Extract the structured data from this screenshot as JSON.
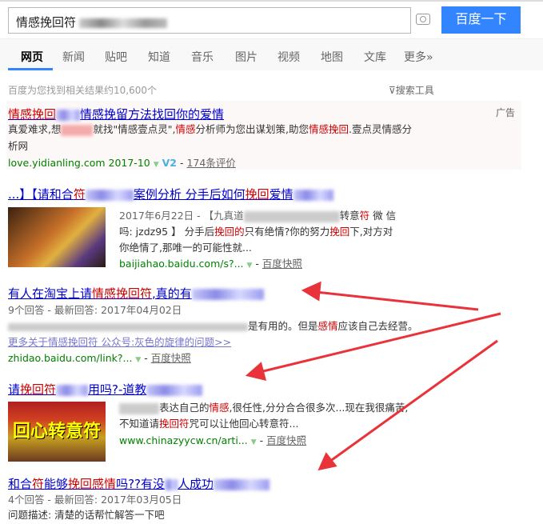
{
  "search": {
    "query": "情感挽回符",
    "button": "百度一下",
    "camera_icon": "camera-icon"
  },
  "tabs": [
    "网页",
    "新闻",
    "贴吧",
    "知道",
    "音乐",
    "图片",
    "视频",
    "地图",
    "文库",
    "更多»"
  ],
  "result_count": "百度为您找到相关结果约10,600个",
  "search_tools": "搜索工具",
  "colors": {
    "accent": "#3385ff",
    "link": "#0000cc",
    "highlight": "#cc0000",
    "url": "#008000",
    "arrow": "#e8333a"
  },
  "results": [
    {
      "ad": "广告",
      "title_a": "情感挽回",
      "title_b": "情感挽留方法找回你的爱情",
      "desc1_a": "真爱难求,想",
      "desc1_b": "就找\"情感壹点灵\",",
      "desc1_hl1": "情感",
      "desc1_c": "分析师为您出谋划策,助您",
      "desc1_hl2": "情感挽回",
      "desc1_d": ".壹点灵情感分",
      "desc2": "析网",
      "url": "love.yidianling.com",
      "date": "2017-10",
      "badge": "V2",
      "reviews": "174条评价"
    },
    {
      "title_a": "...】【请和合",
      "title_hl": "符",
      "title_b": "案例分析 分手后如何",
      "title_hl2": "挽回",
      "title_c": "爱情",
      "date": "2017年6月22日 - 【九真道",
      "d1b": "转意",
      "d1hl": "符",
      "d1c": " 微 信",
      "d2a": "吗: jzdz95 】 分手后",
      "d2hl": "挽回的",
      "d2b": "只有绝情?",
      "d2c": "你的努力",
      "d2hl2": "挽回",
      "d2d": "下,对方对",
      "d3": "你绝情了,那唯一的可能性就...",
      "url": "baijiahao.baidu.com/s?...",
      "snap": "百度快照"
    },
    {
      "title_a": "有人在淘宝上请",
      "title_hl": "情感挽回符",
      "title_b": ",真的有",
      "meta": "9个回答 - 最新回答: 2017年04月02日",
      "d_a": "是有用的。但是",
      "d_hl": "感情",
      "d_b": "应该自己去经营。",
      "more": "更多关于情感挽回符 公众号:灰色的旋律的问题>>",
      "url": "zhidao.baidu.com/link?...",
      "snap": "百度快照"
    },
    {
      "title_a": "请",
      "title_hl": "挽回符",
      "title_b": "用吗?-道教",
      "d1a": "表达自己的",
      "d1hl": "情感",
      "d1b": ",很任性,分分合合很多次...现在我很痛苦,",
      "d2a": "不知道请",
      "d2hl": "挽回符",
      "d2b": "咒可以让他回心转意符...",
      "url": "www.chinazyycw.cn/arti...",
      "snap": "百度快照",
      "image_text": "回心转意符"
    },
    {
      "title_a": "和合",
      "title_hl": "符",
      "title_b": "能够",
      "title_hl2": "挽回感情",
      "title_c": "吗??有没",
      "title_d": "人成功",
      "meta": "4个回答 - 最新回答: 2017年03月05日",
      "desc": "问题描述: 清楚的话帮忙解答一下吧"
    }
  ]
}
